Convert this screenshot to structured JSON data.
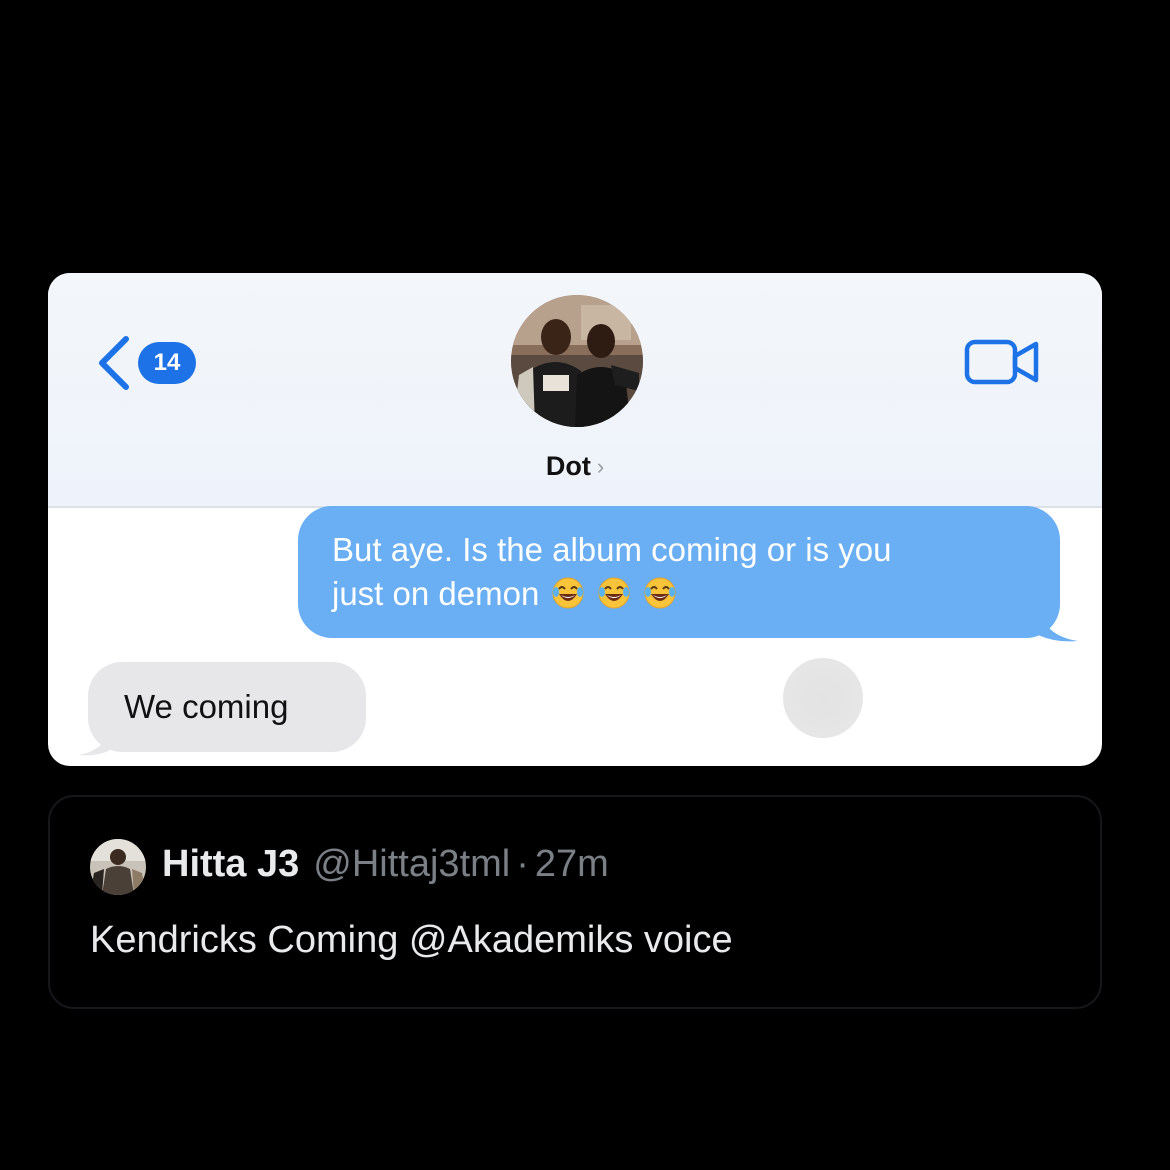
{
  "colors": {
    "background": "#000000",
    "accent_blue": "#1d72e8",
    "outgoing_bubble": "#6aaef3",
    "incoming_bubble": "#e7e7ea",
    "tweet_secondary_text": "#7b8087"
  },
  "imessage": {
    "back": {
      "icon": "chevron-left-icon",
      "unread_count": "14"
    },
    "contact": {
      "name": "Dot",
      "chevron": "›"
    },
    "video_call_icon": "video-camera-icon",
    "messages": [
      {
        "direction": "outgoing",
        "line1": "But aye. Is the album coming or is you",
        "line2": "just on demon",
        "emojis": [
          "laughing-tears-emoji",
          "laughing-tears-emoji",
          "laughing-tears-emoji"
        ]
      },
      {
        "direction": "incoming",
        "text": "We coming"
      }
    ]
  },
  "tweet": {
    "display_name": "Hitta J3",
    "handle": "@Hittaj3tml",
    "separator": "·",
    "time": "27m",
    "text": "Kendricks Coming @Akademiks voice"
  }
}
